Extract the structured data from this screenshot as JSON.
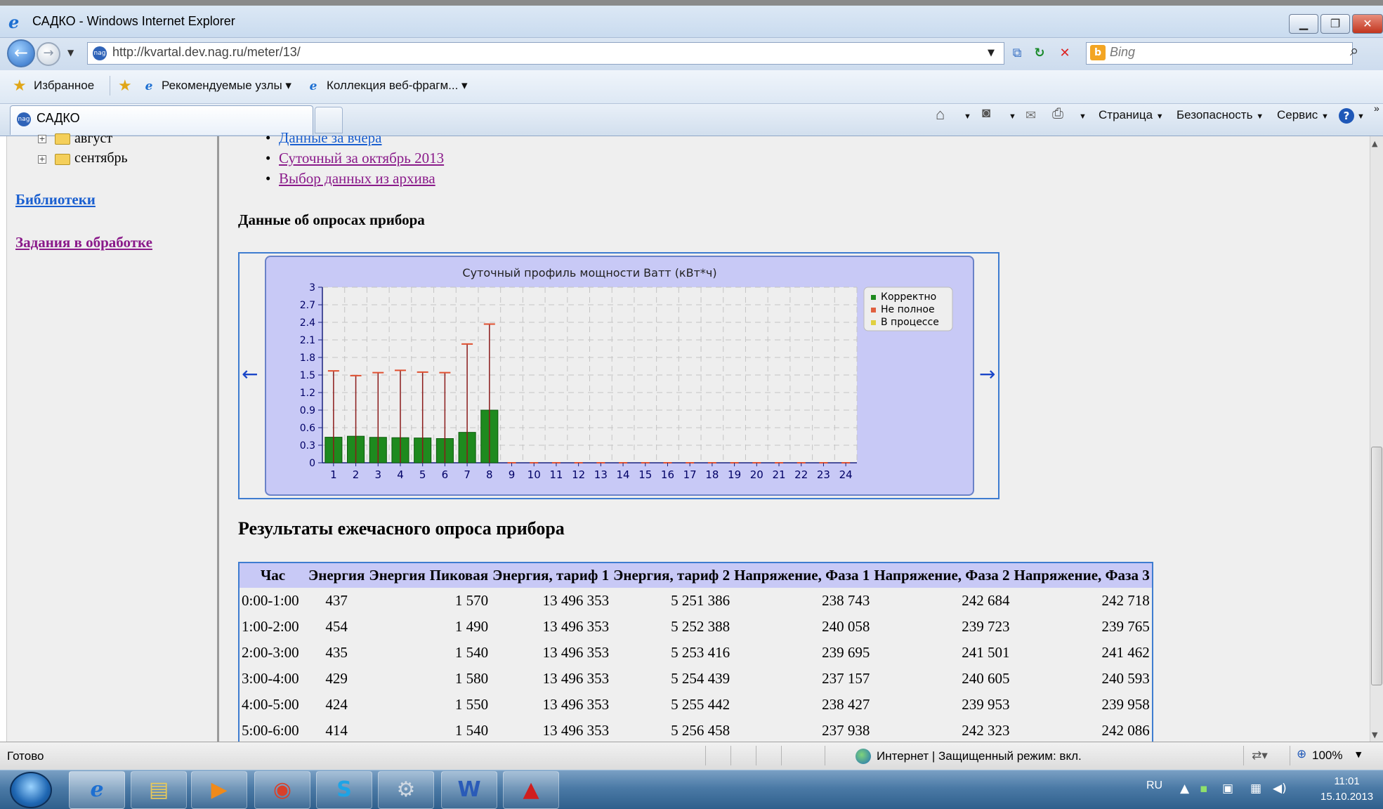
{
  "window": {
    "title": "САДКО - Windows Internet Explorer"
  },
  "address": {
    "url": "http://kvartal.dev.nag.ru/meter/13/",
    "favicon": "nag",
    "search_placeholder": "Bing"
  },
  "favorites": {
    "label": "Избранное",
    "items": [
      "Рекомендуемые узлы ▾",
      "Коллекция веб-фрагм... ▾"
    ]
  },
  "tab": {
    "label": "САДКО"
  },
  "commands": {
    "page": "Страница",
    "safety": "Безопасность",
    "tools": "Сервис"
  },
  "sidebar": {
    "tree": [
      "август",
      "сентябрь"
    ],
    "links": [
      "Библиотеки",
      "Задания в обработке"
    ]
  },
  "main": {
    "bullets": [
      "Данные за вчера",
      "Суточный за октябрь 2013",
      "Выбор данных из архива"
    ],
    "section_title": "Данные об опросах прибора",
    "results_title": "Результаты ежечасного опроса прибора"
  },
  "chart_data": {
    "type": "bar",
    "title": "Суточный профиль мощности Ватт (кВт*ч)",
    "categories": [
      "1",
      "2",
      "3",
      "4",
      "5",
      "6",
      "7",
      "8",
      "9",
      "10",
      "11",
      "12",
      "13",
      "14",
      "15",
      "16",
      "17",
      "18",
      "19",
      "20",
      "21",
      "22",
      "23",
      "24"
    ],
    "series": [
      {
        "name": "Корректно",
        "values": [
          0.437,
          0.454,
          0.435,
          0.429,
          0.424,
          0.414,
          0.52,
          0.9,
          0,
          0,
          0,
          0,
          0,
          0,
          0,
          0,
          0,
          0,
          0,
          0,
          0,
          0,
          0,
          0
        ]
      }
    ],
    "peak": [
      1.57,
      1.49,
      1.54,
      1.58,
      1.55,
      1.54,
      2.03,
      2.37,
      0,
      0,
      0,
      0,
      0,
      0,
      0,
      0,
      0,
      0,
      0,
      0,
      0,
      0,
      0,
      0
    ],
    "legend": [
      "Корректно",
      "Не полное",
      "В процессе"
    ],
    "legend_colors": [
      "#1e8a1e",
      "#e06040",
      "#e0d040"
    ],
    "yticks": [
      "0",
      "0.3",
      "0.6",
      "0.9",
      "1.2",
      "1.5",
      "1.8",
      "2.1",
      "2.4",
      "2.7",
      "3"
    ],
    "ylim": [
      0,
      3
    ],
    "grid": true,
    "legend_position": "top-right",
    "nav": {
      "prev": "←",
      "next": "→"
    }
  },
  "table": {
    "headers": [
      "Час",
      "Энергия",
      "Энергия",
      "Пиковая",
      "Энергия, тариф 1",
      "Энергия, тариф 2",
      "Напряжение, Фаза 1",
      "Напряжение, Фаза 2",
      "Напряжение, Фаза 3"
    ],
    "rows": [
      [
        "0:00-1:00",
        "437",
        "",
        "1 570",
        "13 496 353",
        "5 251 386",
        "238 743",
        "242 684",
        "242 718"
      ],
      [
        "1:00-2:00",
        "454",
        "",
        "1 490",
        "13 496 353",
        "5 252 388",
        "240 058",
        "239 723",
        "239 765"
      ],
      [
        "2:00-3:00",
        "435",
        "",
        "1 540",
        "13 496 353",
        "5 253 416",
        "239 695",
        "241 501",
        "241 462"
      ],
      [
        "3:00-4:00",
        "429",
        "",
        "1 580",
        "13 496 353",
        "5 254 439",
        "237 157",
        "240 605",
        "240 593"
      ],
      [
        "4:00-5:00",
        "424",
        "",
        "1 550",
        "13 496 353",
        "5 255 442",
        "238 427",
        "239 953",
        "239 958"
      ],
      [
        "5:00-6:00",
        "414",
        "",
        "1 540",
        "13 496 353",
        "5 256 458",
        "237 938",
        "242 323",
        "242 086"
      ]
    ]
  },
  "status": {
    "text": "Готово",
    "zone": "Интернет | Защищенный режим: вкл.",
    "zoom": "100%"
  },
  "taskbar": {
    "lang": "RU",
    "time": "11:01",
    "date": "15.10.2013"
  }
}
